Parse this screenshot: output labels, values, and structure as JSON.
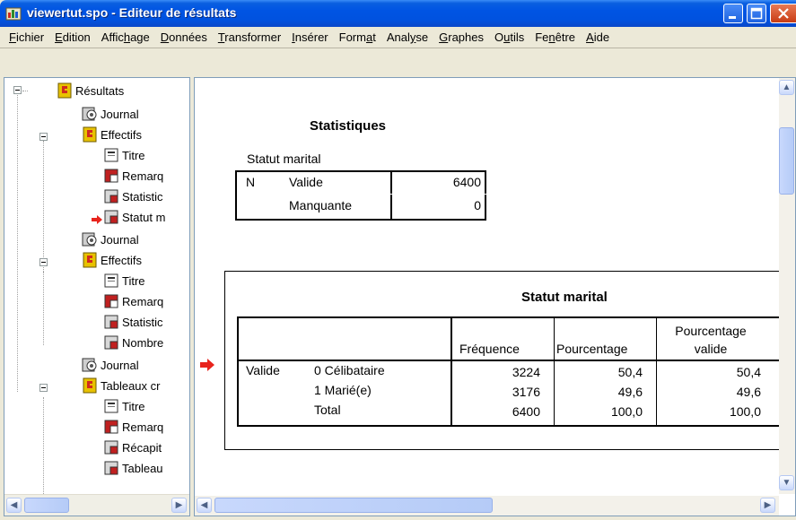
{
  "window": {
    "title": "viewertut.spo - Editeur de résultats"
  },
  "menu": [
    {
      "pre": "",
      "mn": "F",
      "post": "ichier"
    },
    {
      "pre": "",
      "mn": "E",
      "post": "dition"
    },
    {
      "pre": "Affic",
      "mn": "h",
      "post": "age"
    },
    {
      "pre": "",
      "mn": "D",
      "post": "onnées"
    },
    {
      "pre": "",
      "mn": "T",
      "post": "ransformer"
    },
    {
      "pre": "",
      "mn": "I",
      "post": "nsérer"
    },
    {
      "pre": "Form",
      "mn": "a",
      "post": "t"
    },
    {
      "pre": "Anal",
      "mn": "y",
      "post": "se"
    },
    {
      "pre": "",
      "mn": "G",
      "post": "raphes"
    },
    {
      "pre": "O",
      "mn": "u",
      "post": "tils"
    },
    {
      "pre": "Fe",
      "mn": "n",
      "post": "être"
    },
    {
      "pre": "",
      "mn": "A",
      "post": "ide"
    }
  ],
  "outline": [
    {
      "label": "Résultats",
      "icon": "book-icon"
    },
    {
      "label": "Journal",
      "icon": "log-icon"
    },
    {
      "label": "Effectifs",
      "icon": "book-icon"
    },
    {
      "label": "Titre",
      "icon": "title-icon"
    },
    {
      "label": "Remarq",
      "icon": "notes-icon"
    },
    {
      "label": "Statistic",
      "icon": "table-icon"
    },
    {
      "label": "Statut m",
      "icon": "table-icon"
    },
    {
      "label": "Journal",
      "icon": "log-icon"
    },
    {
      "label": "Effectifs",
      "icon": "book-icon"
    },
    {
      "label": "Titre",
      "icon": "title-icon"
    },
    {
      "label": "Remarq",
      "icon": "notes-icon"
    },
    {
      "label": "Statistic",
      "icon": "table-icon"
    },
    {
      "label": "Nombre",
      "icon": "table-icon"
    },
    {
      "label": "Journal",
      "icon": "log-icon"
    },
    {
      "label": "Tableaux cr",
      "icon": "book-icon"
    },
    {
      "label": "Titre",
      "icon": "title-icon"
    },
    {
      "label": "Remarq",
      "icon": "notes-icon"
    },
    {
      "label": "Récapit",
      "icon": "table-icon"
    },
    {
      "label": "Tableau",
      "icon": "table-icon"
    }
  ],
  "statistics": {
    "title": "Statistiques",
    "layer": "Statut marital",
    "row_n": "N",
    "row_valid": "Valide",
    "row_missing": "Manquante",
    "valid_value": "6400",
    "missing_value": "0"
  },
  "frequency": {
    "title": "Statut marital",
    "headers": {
      "frequency": "Fréquence",
      "percent": "Pourcentage",
      "valid_percent_1": "Pourcentage",
      "valid_percent_2": "valide"
    },
    "group_label": "Valide",
    "rows": [
      {
        "label": "0  Célibataire",
        "freq": "3224",
        "pct": "50,4",
        "vpct": "50,4"
      },
      {
        "label": "1  Marié(e)",
        "freq": "3176",
        "pct": "49,6",
        "vpct": "49,6"
      },
      {
        "label": "Total",
        "freq": "6400",
        "pct": "100,0",
        "vpct": "100,0"
      }
    ]
  },
  "colors": {
    "titlebar": "#0054e3",
    "selection_arrow": "#e8241d",
    "book_icon": "#e8c200"
  }
}
